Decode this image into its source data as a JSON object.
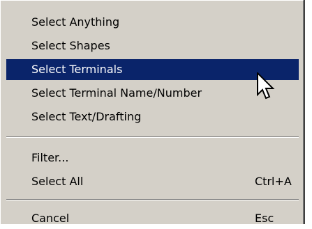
{
  "menu": {
    "items": [
      {
        "label": "Select Anything",
        "shortcut": ""
      },
      {
        "label": "Select Shapes",
        "shortcut": ""
      },
      {
        "label": "Select Terminals",
        "shortcut": "",
        "highlighted": true
      },
      {
        "label": "Select Terminal Name/Number",
        "shortcut": ""
      },
      {
        "label": "Select Text/Drafting",
        "shortcut": ""
      },
      {
        "label": "Filter...",
        "shortcut": ""
      },
      {
        "label": "Select All",
        "shortcut": "Ctrl+A"
      },
      {
        "label": "Cancel",
        "shortcut": "Esc"
      }
    ]
  },
  "cursor": {
    "icon": "arrow-pointer-icon"
  },
  "colors": {
    "menu_background": "#d4d0c8",
    "highlight_background": "#0a246a",
    "highlight_text": "#ffffff"
  }
}
